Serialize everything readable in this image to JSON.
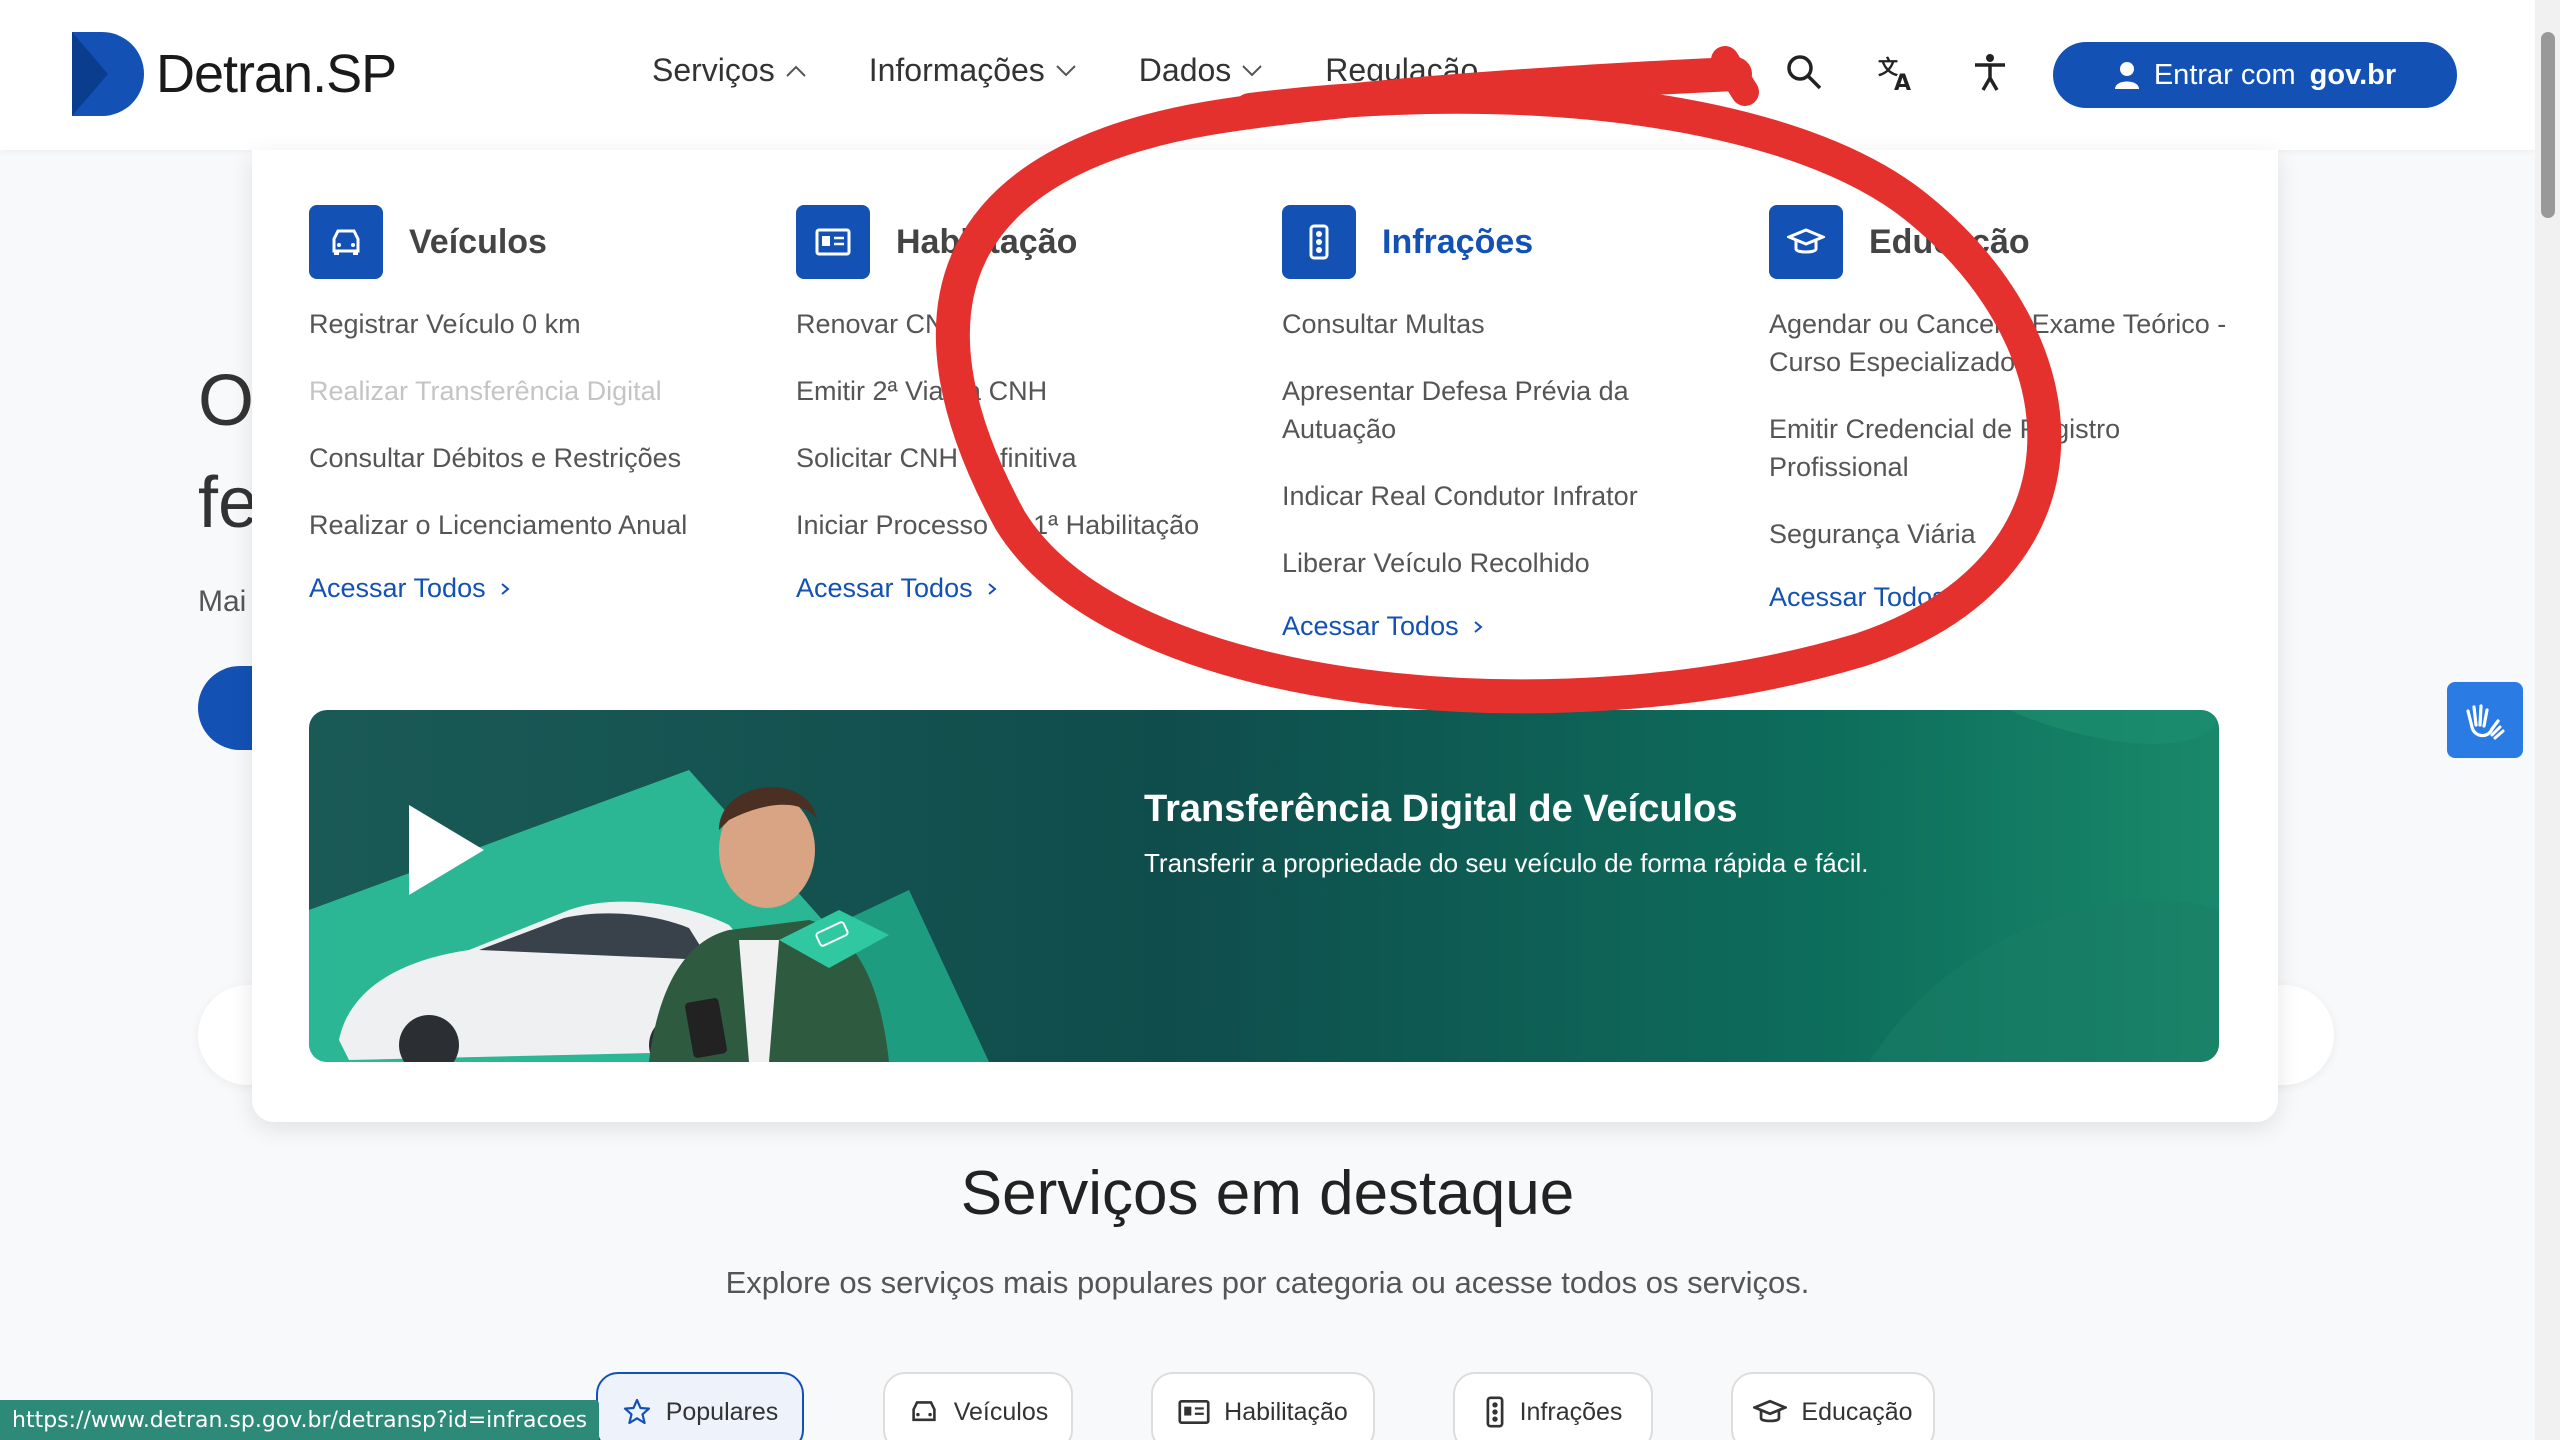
{
  "brand": {
    "name": "Detran.SP"
  },
  "nav": [
    {
      "label": "Serviços",
      "open": true
    },
    {
      "label": "Informações",
      "open": false
    },
    {
      "label": "Dados",
      "open": false
    },
    {
      "label": "Regulação",
      "open": false
    }
  ],
  "login": {
    "prefix": "Entrar com",
    "brand": "gov.br"
  },
  "hero": {
    "line1": "O",
    "line2": "fe",
    "line3": "Mai"
  },
  "menu": {
    "columns": [
      {
        "title": "Veículos",
        "icon": "car-icon",
        "links": [
          "Registrar Veículo 0 km",
          "Realizar Transferência Digital",
          "Consultar Débitos e Restrições",
          "Realizar o Licenciamento Anual"
        ],
        "all": "Acessar Todos"
      },
      {
        "title": "Habilitação",
        "icon": "license-card-icon",
        "links": [
          "Renovar CNH",
          "Emitir 2ª Via da CNH",
          "Solicitar CNH Definitiva",
          "Iniciar Processo de 1ª Habilitação"
        ],
        "all": "Acessar Todos"
      },
      {
        "title": "Infrações",
        "icon": "traffic-light-icon",
        "links": [
          "Consultar Multas",
          "Apresentar Defesa Prévia da Autuação",
          "Indicar Real Condutor Infrator",
          "Liberar Veículo Recolhido"
        ],
        "all": "Acessar Todos"
      },
      {
        "title": "Educação",
        "icon": "graduation-cap-icon",
        "links": [
          "Agendar ou Cancelar Exame Teórico - Curso Especializado",
          "Emitir Credencial de Registro Profissional",
          "Segurança Viária"
        ],
        "all": "Acessar Todos"
      }
    ]
  },
  "banner": {
    "title": "Transferência Digital de Veículos",
    "subtitle": "Transferir a propriedade do seu veículo de forma rápida e fácil."
  },
  "featured": {
    "title": "Serviços em destaque",
    "subtitle": "Explore os serviços mais populares por categoria ou acesse todos os serviços.",
    "tabs": [
      {
        "label": "Populares",
        "icon": "star-icon",
        "active": true
      },
      {
        "label": "Veículos",
        "icon": "car-icon",
        "active": false
      },
      {
        "label": "Habilitação",
        "icon": "license-card-icon",
        "active": false
      },
      {
        "label": "Infrações",
        "icon": "traffic-light-icon",
        "active": false
      },
      {
        "label": "Educação",
        "icon": "graduation-cap-icon",
        "active": false
      }
    ]
  },
  "status_url": "https://www.detran.sp.gov.br/detransp?id=infracoes",
  "colors": {
    "primary": "#1351b4",
    "annotation": "#e5312e",
    "banner": "#0f4d4c"
  }
}
